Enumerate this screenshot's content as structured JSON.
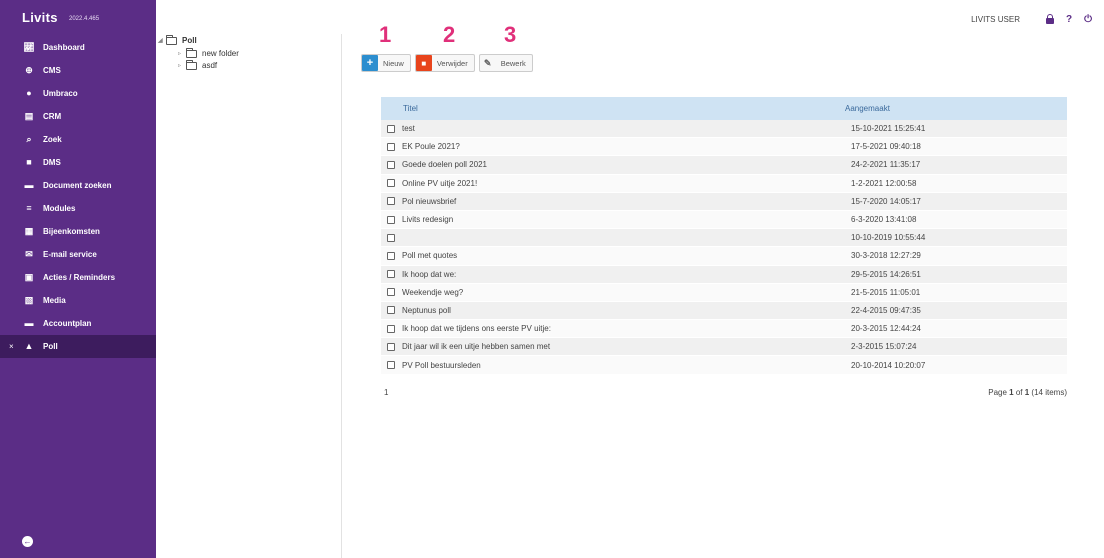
{
  "app": {
    "brand": "Livits",
    "version": "2022.4.465"
  },
  "sidebar": {
    "items": [
      {
        "label": "Dashboard",
        "icon": "dashboard-icon"
      },
      {
        "label": "CMS",
        "icon": "globe-icon"
      },
      {
        "label": "Umbraco",
        "icon": "circle-icon"
      },
      {
        "label": "CRM",
        "icon": "id-card-icon"
      },
      {
        "label": "Zoek",
        "icon": "search-icon"
      },
      {
        "label": "DMS",
        "icon": "file-icon"
      },
      {
        "label": "Document zoeken",
        "icon": "archive-icon"
      },
      {
        "label": "Modules",
        "icon": "list-icon"
      },
      {
        "label": "Bijeenkomsten",
        "icon": "calendar-icon"
      },
      {
        "label": "E-mail service",
        "icon": "mail-icon"
      },
      {
        "label": "Acties / Reminders",
        "icon": "clipboard-icon"
      },
      {
        "label": "Media",
        "icon": "media-file-icon"
      },
      {
        "label": "Accountplan",
        "icon": "folder-icon"
      },
      {
        "label": "Poll",
        "icon": "chart-icon",
        "active": true,
        "close": "×"
      }
    ]
  },
  "tree": {
    "root": "Poll",
    "children": [
      "new folder",
      "asdf"
    ]
  },
  "header": {
    "user": "LIVITS USER",
    "help": "?"
  },
  "annotations": [
    "1",
    "2",
    "3"
  ],
  "toolbar": {
    "new_label": "Nieuw",
    "delete_label": "Verwijder",
    "edit_label": "Bewerk"
  },
  "grid": {
    "columns": [
      "Titel",
      "Aangemaakt"
    ],
    "rows": [
      {
        "title": "test",
        "created": "15-10-2021 15:25:41"
      },
      {
        "title": "EK Poule 2021?",
        "created": "17-5-2021 09:40:18"
      },
      {
        "title": "Goede doelen poll 2021",
        "created": "24-2-2021 11:35:17"
      },
      {
        "title": "Online PV uitje 2021!",
        "created": "1-2-2021 12:00:58"
      },
      {
        "title": "Pol nieuwsbrief",
        "created": "15-7-2020 14:05:17"
      },
      {
        "title": "Livits redesign",
        "created": "6-3-2020 13:41:08"
      },
      {
        "title": "",
        "created": "10-10-2019 10:55:44"
      },
      {
        "title": "Poll met quotes",
        "created": "30-3-2018 12:27:29"
      },
      {
        "title": "Ik hoop dat we:",
        "created": "29-5-2015 14:26:51"
      },
      {
        "title": "Weekendje weg?",
        "created": "21-5-2015 11:05:01"
      },
      {
        "title": "Neptunus poll",
        "created": "22-4-2015 09:47:35"
      },
      {
        "title": "Ik hoop dat we tijdens ons eerste PV uitje:",
        "created": "20-3-2015 12:44:24"
      },
      {
        "title": "Dit jaar wil ik een uitje hebben samen met",
        "created": "2-3-2015 15:07:24"
      },
      {
        "title": "PV Poll bestuursleden",
        "created": "20-10-2014 10:20:07"
      }
    ]
  },
  "pager": {
    "page_link": "1",
    "summary_prefix": "Page ",
    "current": "1",
    "of": " of ",
    "total": "1",
    "items": " (14 items)"
  },
  "colors": {
    "sidebar": "#5b2d86",
    "header_row": "#cfe3f3",
    "accent_new": "#2c8ecf",
    "accent_delete": "#e8441c",
    "annotation": "#e0307a"
  }
}
